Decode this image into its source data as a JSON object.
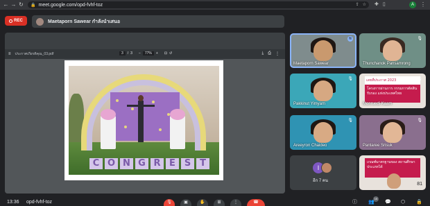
{
  "browser": {
    "url": "meet.google.com/opd-fvhf-toz",
    "profile_initial": "A"
  },
  "meeting": {
    "rec_label": "REC",
    "presenter_text": "Maetaporn Sawear กำลังนำเสนอ",
    "clock": "13:36",
    "code": "opd-fvhf-toz",
    "participant_count": "15"
  },
  "pdf": {
    "title": "ประกาศเกียรติคุณ_03.pdf",
    "page_current": "3",
    "page_total": "3",
    "zoom": "77%"
  },
  "photo": {
    "letters": [
      "C",
      "O",
      "N",
      "G",
      "R",
      "E",
      "S",
      "T"
    ]
  },
  "participants": [
    {
      "name": "Maetaporn Sawear",
      "speaking": true
    },
    {
      "name": "Thunchanok Pansamrong",
      "speaking": false
    },
    {
      "name": "Pakkinut Yimyam",
      "speaking": false
    },
    {
      "name": "Monruedi Kaam",
      "speaking": false
    },
    {
      "name": "Areeyron Chaideo",
      "speaking": false
    },
    {
      "name": "Pantaree Srisuk",
      "speaking": false
    },
    {
      "name": "อีก 7 คน",
      "speaking": false
    },
    {
      "name": "",
      "speaking": false
    }
  ],
  "signs": {
    "header_text": "เลขที่ประกาศ 2023",
    "body_text": "โครงการผ่านการ กรรมการตัดสินรับรอง แห่งประเทศไทย",
    "body_text_2": "เกณฑ์มาตรฐานของ สถานศึกษาประเภทได้",
    "number_text": "81"
  },
  "others_initial": "I",
  "colors": {
    "accent_blue": "#8ab4f8",
    "rec_red": "#d93025",
    "end_call_red": "#ea4335",
    "background": "#202124"
  }
}
